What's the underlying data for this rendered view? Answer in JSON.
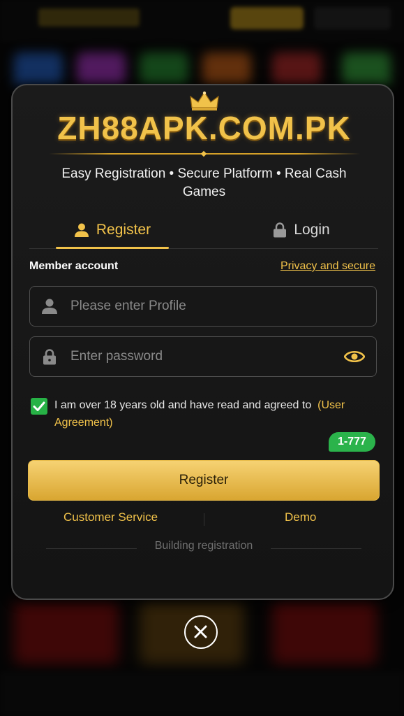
{
  "brand": {
    "name": "ZH88APK.COM.PK",
    "tagline": "Easy Registration • Secure Platform • Real Cash Games"
  },
  "tabs": [
    {
      "label": "Register",
      "icon": "user-icon",
      "active": true
    },
    {
      "label": "Login",
      "icon": "lock-icon",
      "active": false
    }
  ],
  "form": {
    "member_label": "Member account",
    "privacy_link": "Privacy and secure",
    "profile_placeholder": "Please enter Profile",
    "password_placeholder": "Enter password",
    "agreement_text": "I am over 18 years old and have read and agreed to",
    "agreement_link": "(User Agreement)",
    "agreement_checked": true,
    "badge": "1-777",
    "register_button": "Register"
  },
  "footer": {
    "customer_service": "Customer Service",
    "demo": "Demo",
    "building_registration": "Building registration"
  },
  "colors": {
    "accent_gold": "#f1c24a",
    "check_green": "#27b246",
    "badge_green": "#2bb34b"
  }
}
